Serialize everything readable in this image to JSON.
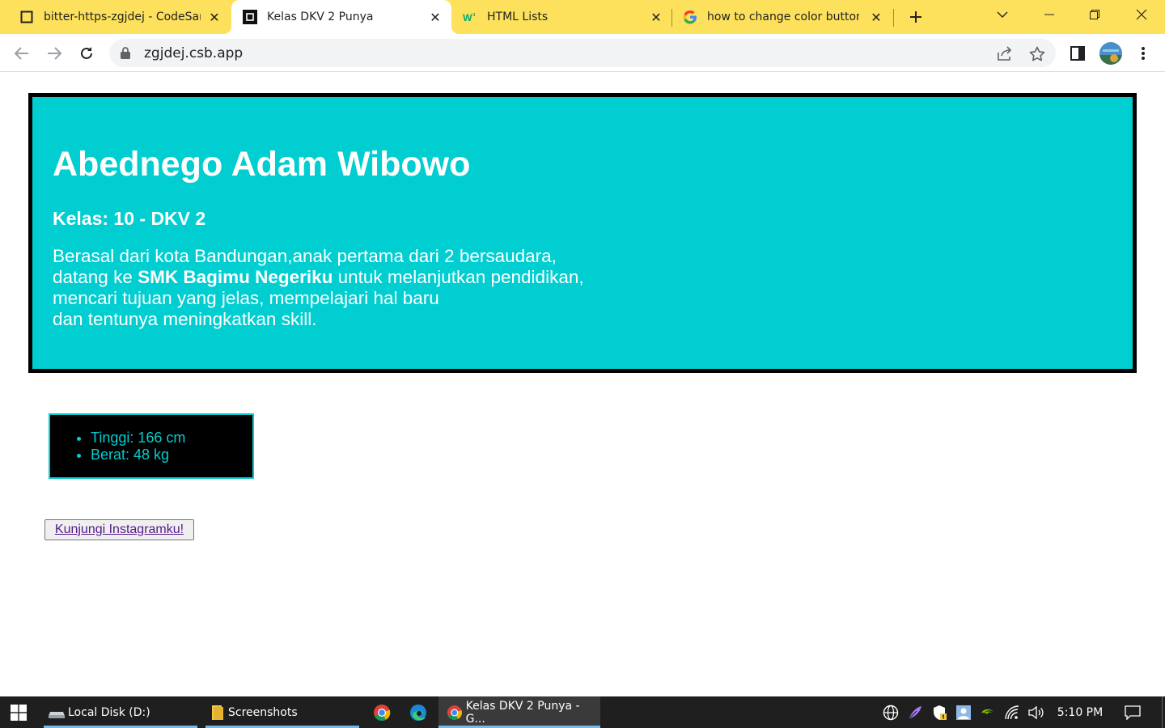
{
  "browser": {
    "tabs": [
      {
        "title": "bitter-https-zgjdej - CodeSan",
        "active": false
      },
      {
        "title": "Kelas DKV 2 Punya",
        "active": true
      },
      {
        "title": "HTML Lists",
        "active": false
      },
      {
        "title": "how to change color button i",
        "active": false
      }
    ],
    "url": "zgjdej.csb.app",
    "colors": {
      "tabstrip": "#FDE15C",
      "toolbar": "#ffffff"
    }
  },
  "page": {
    "name": "Abednego Adam Wibowo",
    "kelas": "Kelas: 10 - DKV 2",
    "bio": {
      "line1": "Berasal dari kota Bandungan,anak pertama dari 2 bersaudara,",
      "line2_pre": "datang ke ",
      "line2_bold": "SMK Bagimu Negeriku",
      "line2_post": " untuk melanjutkan pendidikan,",
      "line3": "mencari tujuan yang jelas, mempelajari hal baru",
      "line4": "dan tentunya meningkatkan skill."
    },
    "stats": [
      "Tinggi: 166 cm",
      "Berat: 48 kg"
    ],
    "button_label": "Kunjungi Instagramku!",
    "colors": {
      "accent": "#00CED1",
      "border": "#000000",
      "text": "#ffffff"
    }
  },
  "taskbar": {
    "items": [
      {
        "label": "Local Disk (D:)",
        "icon": "drive-icon"
      },
      {
        "label": "Screenshots",
        "icon": "folder-icon"
      },
      {
        "label": "",
        "icon": "chrome-icon"
      },
      {
        "label": "",
        "icon": "edge-icon"
      },
      {
        "label": "Kelas DKV 2 Punya - G...",
        "icon": "chrome-icon"
      }
    ],
    "time": "5:10 PM"
  }
}
